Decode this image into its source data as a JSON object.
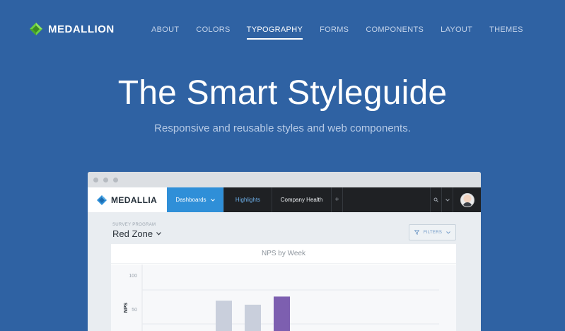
{
  "site": {
    "brand": "MEDALLION",
    "nav": [
      {
        "label": "ABOUT",
        "active": false
      },
      {
        "label": "COLORS",
        "active": false
      },
      {
        "label": "TYPOGRAPHY",
        "active": true
      },
      {
        "label": "FORMS",
        "active": false
      },
      {
        "label": "COMPONENTS",
        "active": false
      },
      {
        "label": "LAYOUT",
        "active": false
      },
      {
        "label": "THEMES",
        "active": false
      }
    ]
  },
  "hero": {
    "title": "The Smart Styleguide",
    "subtitle": "Responsive and reusable styles and web components."
  },
  "app": {
    "brand": "MEDALLIA",
    "tabs": {
      "dashboards": "Dashboards",
      "highlights": "Highlights",
      "company_health": "Company Health",
      "add": "+"
    },
    "survey_program_label": "SURVEY PROGRAM",
    "survey_program_value": "Red Zone",
    "filters_label": "FILTERS",
    "card_title": "NPS by Week"
  },
  "colors": {
    "background": "#2f62a3",
    "active_tab": "#2f8fd8",
    "bar_default": "#c9cfdc",
    "bar_highlight": "#7d5fb0"
  },
  "chart_data": {
    "type": "bar",
    "title": "NPS by Week",
    "ylabel": "NPS",
    "yticks": [
      100,
      50
    ],
    "ylim": [
      0,
      100
    ],
    "series": [
      {
        "values": [
          77,
          71,
          83
        ]
      }
    ],
    "highlight_index": 2
  }
}
